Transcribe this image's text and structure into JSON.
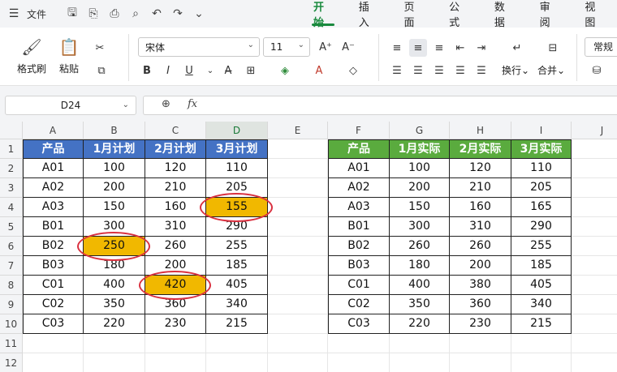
{
  "titlebar": {
    "file_label": "文件",
    "tabs": [
      {
        "label": "开始",
        "active": true
      },
      {
        "label": "插入",
        "active": false
      },
      {
        "label": "页面",
        "active": false
      },
      {
        "label": "公式",
        "active": false
      },
      {
        "label": "数据",
        "active": false
      },
      {
        "label": "审阅",
        "active": false
      },
      {
        "label": "视图",
        "active": false
      }
    ]
  },
  "ribbon": {
    "format_painter": "格式刷",
    "paste": "粘贴",
    "font_name": "宋体",
    "font_size": "11",
    "bold": "B",
    "italic": "I",
    "underline": "U",
    "wrap": "换行",
    "merge": "合并",
    "number_format": "常规"
  },
  "formula_bar": {
    "name_box": "D24",
    "fx": "fx",
    "formula": ""
  },
  "sheet": {
    "columns": [
      "A",
      "B",
      "C",
      "D",
      "E",
      "F",
      "G",
      "H",
      "I",
      "J"
    ],
    "active_column": "D",
    "rows": [
      "1",
      "2",
      "3",
      "4",
      "5",
      "6",
      "7",
      "8",
      "9",
      "10",
      "11",
      "12"
    ],
    "plan_table": {
      "headers": [
        "产品",
        "1月计划",
        "2月计划",
        "3月计划"
      ],
      "rows": [
        [
          "A01",
          "100",
          "120",
          "110"
        ],
        [
          "A02",
          "200",
          "210",
          "205"
        ],
        [
          "A03",
          "150",
          "160",
          "155"
        ],
        [
          "B01",
          "300",
          "310",
          "290"
        ],
        [
          "B02",
          "250",
          "260",
          "255"
        ],
        [
          "B03",
          "180",
          "200",
          "185"
        ],
        [
          "C01",
          "400",
          "420",
          "405"
        ],
        [
          "C02",
          "350",
          "360",
          "340"
        ],
        [
          "C03",
          "220",
          "230",
          "215"
        ]
      ],
      "highlighted": [
        [
          2,
          3
        ],
        [
          4,
          1
        ],
        [
          6,
          2
        ]
      ]
    },
    "actual_table": {
      "headers": [
        "产品",
        "1月实际",
        "2月实际",
        "3月实际"
      ],
      "rows": [
        [
          "A01",
          "100",
          "120",
          "110"
        ],
        [
          "A02",
          "200",
          "210",
          "205"
        ],
        [
          "A03",
          "150",
          "160",
          "165"
        ],
        [
          "B01",
          "300",
          "310",
          "290"
        ],
        [
          "B02",
          "260",
          "260",
          "255"
        ],
        [
          "B03",
          "180",
          "200",
          "185"
        ],
        [
          "C01",
          "400",
          "380",
          "405"
        ],
        [
          "C02",
          "350",
          "360",
          "340"
        ],
        [
          "C03",
          "220",
          "230",
          "215"
        ]
      ]
    },
    "colors": {
      "plan_header": "#4472c4",
      "actual_header": "#5aab3e",
      "highlight": "#f1b800",
      "circle": "#d9303f",
      "accent": "#1a8a3e"
    }
  }
}
